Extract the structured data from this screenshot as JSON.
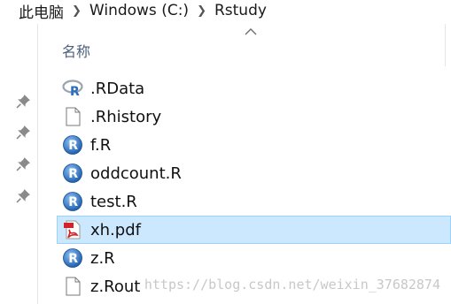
{
  "breadcrumb": {
    "items": [
      "此电脑",
      "Windows (C:)",
      "Rstudy"
    ],
    "separator_icon": "chevron-right-icon"
  },
  "columns": {
    "name_header": "名称",
    "sort_icon": "sort-ascending-icon"
  },
  "nav_pane": {
    "pins": [
      "pin-icon",
      "pin-icon",
      "pin-icon",
      "pin-icon"
    ]
  },
  "files": [
    {
      "name": ".RData",
      "icon": "r-data-icon",
      "selected": false
    },
    {
      "name": ".Rhistory",
      "icon": "blank-file-icon",
      "selected": false
    },
    {
      "name": "f.R",
      "icon": "r-script-icon",
      "selected": false
    },
    {
      "name": "oddcount.R",
      "icon": "r-script-icon",
      "selected": false
    },
    {
      "name": "test.R",
      "icon": "r-script-icon",
      "selected": false
    },
    {
      "name": "xh.pdf",
      "icon": "pdf-icon",
      "selected": true
    },
    {
      "name": "z.R",
      "icon": "r-script-icon",
      "selected": false
    },
    {
      "name": "z.Rout",
      "icon": "blank-file-icon",
      "selected": false
    }
  ],
  "watermark": "https://blog.csdn.net/weixin_37682874",
  "colors": {
    "selection_bg": "#cce8ff",
    "selection_border": "#99d1ff",
    "r_blue": "#2a6ebb",
    "pdf_red": "#d2232a"
  }
}
